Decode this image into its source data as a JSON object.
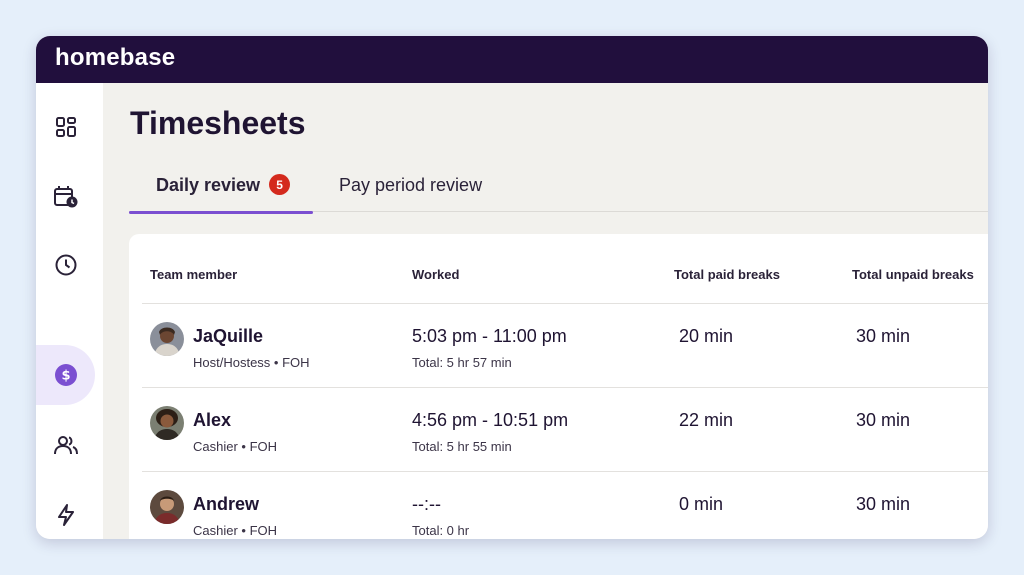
{
  "app": {
    "logo": "homebase"
  },
  "sidebar": {
    "items": [
      {
        "icon": "dashboard-icon"
      },
      {
        "icon": "calendar-clock-icon"
      },
      {
        "icon": "clock-icon"
      },
      {
        "icon": "dollar-icon",
        "active": true
      },
      {
        "icon": "team-icon"
      },
      {
        "icon": "lightning-icon"
      }
    ]
  },
  "page": {
    "title": "Timesheets"
  },
  "tabs": {
    "daily": {
      "label": "Daily review",
      "badge": "5"
    },
    "pay": {
      "label": "Pay period review"
    }
  },
  "table": {
    "headers": {
      "member": "Team member",
      "worked": "Worked",
      "paid": "Total paid breaks",
      "unpaid": "Total unpaid breaks"
    },
    "rows": [
      {
        "name": "JaQuille",
        "role": "Host/Hostess • FOH",
        "time": "5:03 pm - 11:00 pm",
        "total": "Total: 5 hr 57 min",
        "paid": "20 min",
        "unpaid": "30 min"
      },
      {
        "name": "Alex",
        "role": "Cashier • FOH",
        "time": "4:56 pm - 10:51 pm",
        "total": "Total: 5 hr 55 min",
        "paid": "22 min",
        "unpaid": "30 min"
      },
      {
        "name": "Andrew",
        "role": "Cashier • FOH",
        "time": "--:--",
        "total": "Total: 0 hr",
        "paid": "0 min",
        "unpaid": "30 min"
      }
    ]
  },
  "colors": {
    "topbar": "#210f3d",
    "accent": "#7b4fd1",
    "badge": "#d42a1d",
    "background": "#e5effa"
  }
}
